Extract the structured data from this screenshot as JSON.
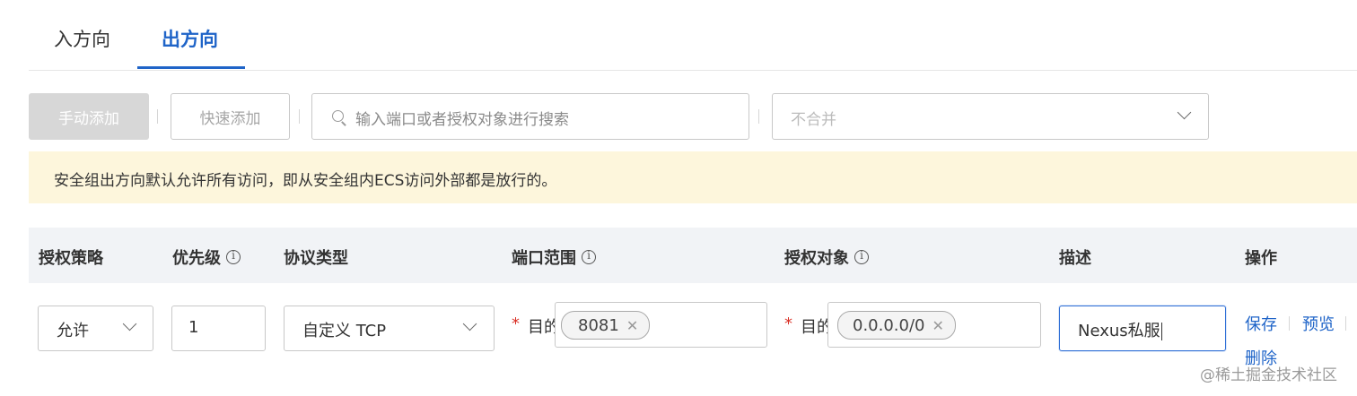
{
  "tabs": [
    {
      "label": "入方向"
    },
    {
      "label": "出方向"
    }
  ],
  "toolbar": {
    "manual_add": "手动添加",
    "quick_add": "快速添加",
    "search_placeholder": "输入端口或者授权对象进行搜索",
    "merge_select": "不合并"
  },
  "notice": "安全组出方向默认允许所有访问，即从安全组内ECS访问外部都是放行的。",
  "table": {
    "headers": [
      "授权策略",
      "优先级",
      "协议类型",
      "端口范围",
      "授权对象",
      "描述",
      "操作"
    ],
    "row": {
      "policy": "允许",
      "priority": "1",
      "protocol": "自定义 TCP",
      "required_mark": "*",
      "dest_label": "目的",
      "port_tag": "8081",
      "object_tag": "0.0.0.0/0",
      "description": "Nexus私服",
      "actions": [
        "保存",
        "预览",
        "删除"
      ]
    }
  },
  "watermark": "@稀土掘金技术社区",
  "colors": {
    "accent": "#1f64c8",
    "notice_bg": "#fdf6dc",
    "required": "#d93026"
  }
}
